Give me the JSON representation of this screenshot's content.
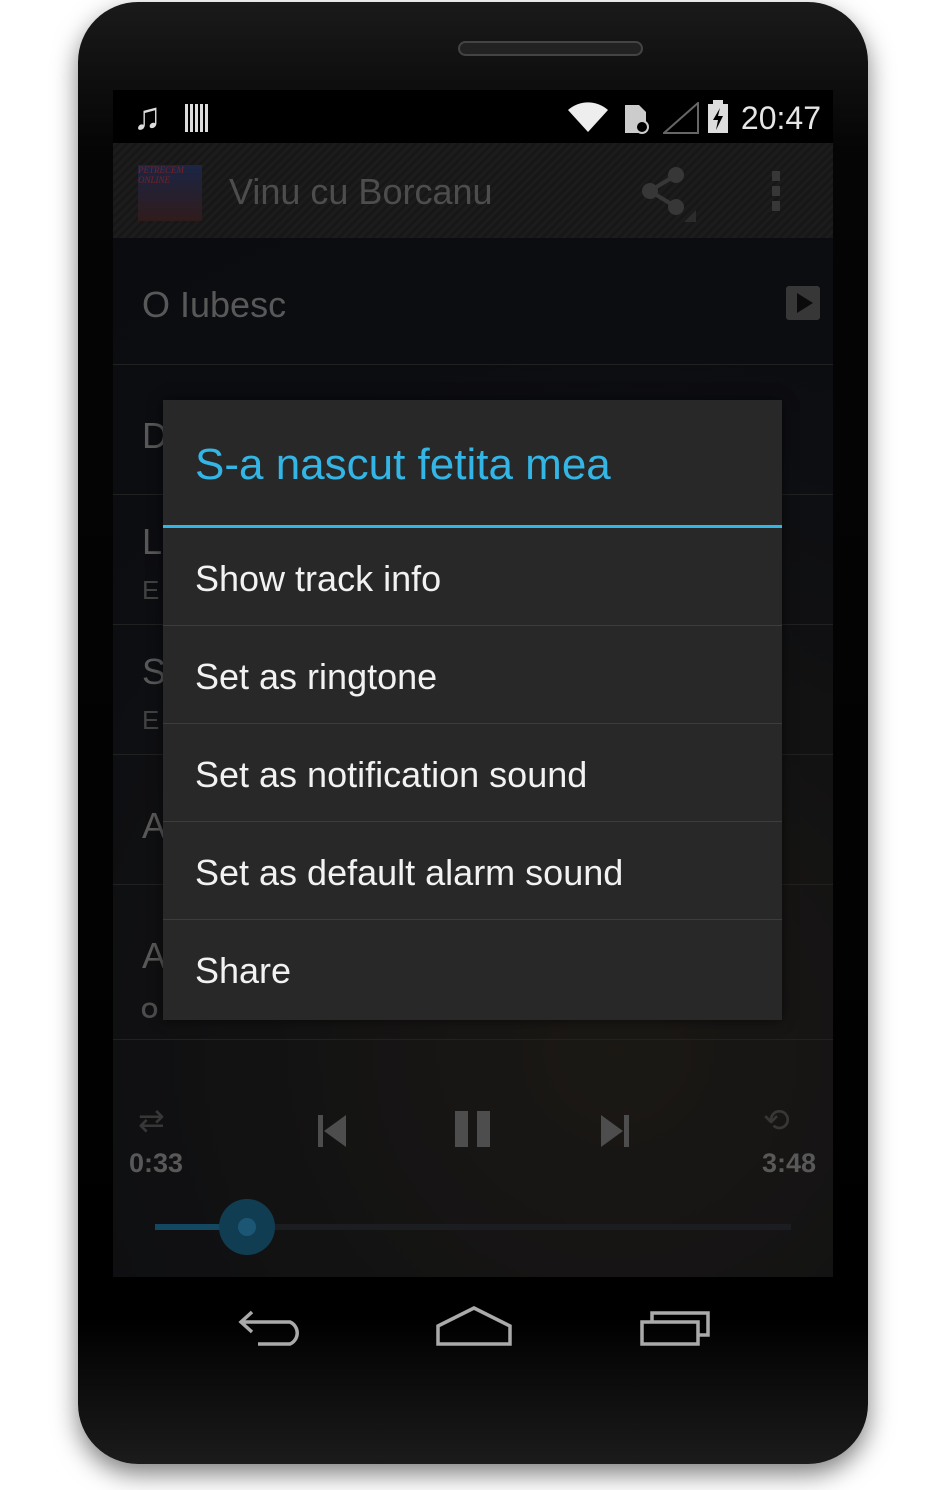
{
  "status_bar": {
    "time": "20:47",
    "icons": [
      "music-note-icon",
      "barcode-icon",
      "wifi-icon",
      "sim-icon",
      "signal-icon",
      "battery-charging-icon"
    ]
  },
  "action_bar": {
    "album_art_text": "PETRECEM ONLINE",
    "title": "Vinu cu Borcanu",
    "icons": [
      "share-icon",
      "overflow-menu-icon"
    ]
  },
  "list": [
    {
      "title": "O Iubesc",
      "subtitle": ""
    },
    {
      "title": "D",
      "subtitle": ""
    },
    {
      "title": "L",
      "subtitle": "E"
    },
    {
      "title": "S",
      "subtitle": "E"
    },
    {
      "title": "A",
      "subtitle": ""
    },
    {
      "title": "A",
      "subtitle": ""
    }
  ],
  "dialog": {
    "title": "S-a nascut fetita mea",
    "items": [
      "Show track info",
      "Set as ringtone",
      "Set as notification sound",
      "Set as default alarm sound",
      "Share"
    ]
  },
  "player": {
    "now_playing": "O Iubesc",
    "elapsed": "0:33",
    "duration": "3:48",
    "progress": 0.145,
    "state": "playing"
  },
  "colors": {
    "accent": "#33b5e5",
    "dialog_bg": "#282828"
  }
}
